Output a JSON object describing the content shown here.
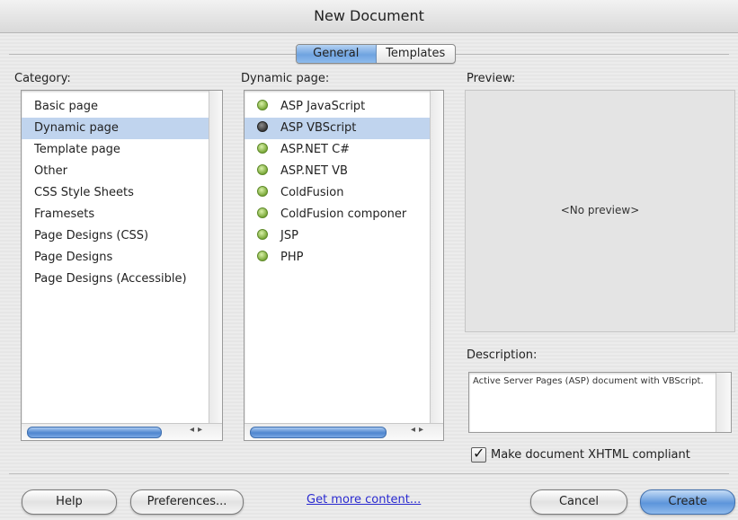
{
  "window": {
    "title": "New Document"
  },
  "tabs": [
    {
      "label": "General",
      "active": true
    },
    {
      "label": "Templates",
      "active": false
    }
  ],
  "category": {
    "label": "Category:",
    "items": [
      "Basic page",
      "Dynamic page",
      "Template page",
      "Other",
      "CSS Style Sheets",
      "Framesets",
      "Page Designs (CSS)",
      "Page Designs",
      "Page Designs (Accessible)"
    ],
    "selected": "Dynamic page"
  },
  "dynamic": {
    "label": "Dynamic page:",
    "items": [
      "ASP JavaScript",
      "ASP VBScript",
      "ASP.NET C#",
      "ASP.NET VB",
      "ColdFusion",
      "ColdFusion componer",
      "JSP",
      "PHP"
    ],
    "selected": "ASP VBScript"
  },
  "preview": {
    "label": "Preview:",
    "placeholder": "<No preview>"
  },
  "description": {
    "label": "Description:",
    "text": "Active Server Pages (ASP) document with VBScript."
  },
  "xhtml": {
    "label": "Make document XHTML compliant",
    "checked": true
  },
  "buttons": {
    "help": "Help",
    "preferences": "Preferences...",
    "more_content": "Get more content...",
    "cancel": "Cancel",
    "create": "Create"
  },
  "colors": {
    "selection": "#c0d4ee",
    "accent": "#5d95db",
    "link": "#2a2ad0",
    "icon_green": "#7caa3a"
  }
}
